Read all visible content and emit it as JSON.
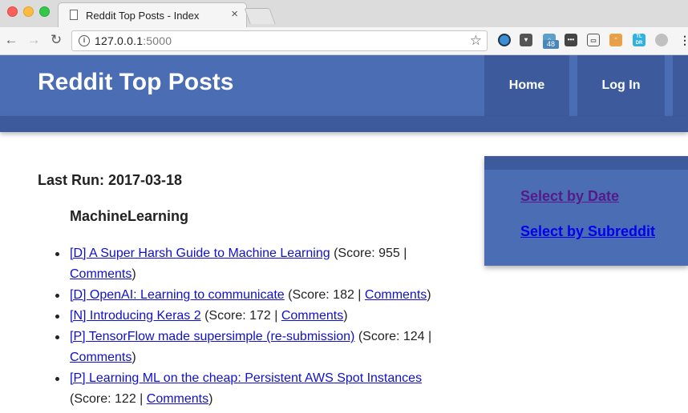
{
  "browser": {
    "tab_title": "Reddit Top Posts - Index",
    "url_host": "127.0.0.1",
    "url_port": ":5000",
    "ext_badge": "48",
    "ext_tldr": "TL DR"
  },
  "site": {
    "title": "Reddit Top Posts",
    "nav": {
      "home": "Home",
      "login": "Log In"
    }
  },
  "content": {
    "last_run": "Last Run: 2017-03-18",
    "subreddit": "MachineLearning",
    "posts": [
      {
        "title": "[D] A Super Harsh Guide to Machine Learning",
        "score_text": " (Score: 955 | ",
        "comments": "Comments",
        "close": ")"
      },
      {
        "title": "[D] OpenAI: Learning to communicate",
        "score_text": " (Score: 182 | ",
        "comments": "Comments",
        "close": ")"
      },
      {
        "title": "[N] Introducing Keras 2",
        "score_text": " (Score: 172 | ",
        "comments": "Comments",
        "close": ")"
      },
      {
        "title": "[P] TensorFlow made supersimple (re-submission)",
        "score_text": " (Score: 124 | ",
        "comments": "Comments",
        "close": ")"
      },
      {
        "title": "[P] Learning ML on the cheap: Persistent AWS Spot Instances",
        "score_text": " (Score: 122 | ",
        "comments": "Comments",
        "close": ")"
      }
    ]
  },
  "sidebar": {
    "select_by_date": "Select by Date",
    "select_by_subreddit": "Select by Subreddit"
  },
  "colors": {
    "header_blue": "#4b6db3",
    "header_dark_blue": "#3d5b9c",
    "link_blue": "#1010cc",
    "visited_purple": "#551a8b"
  }
}
